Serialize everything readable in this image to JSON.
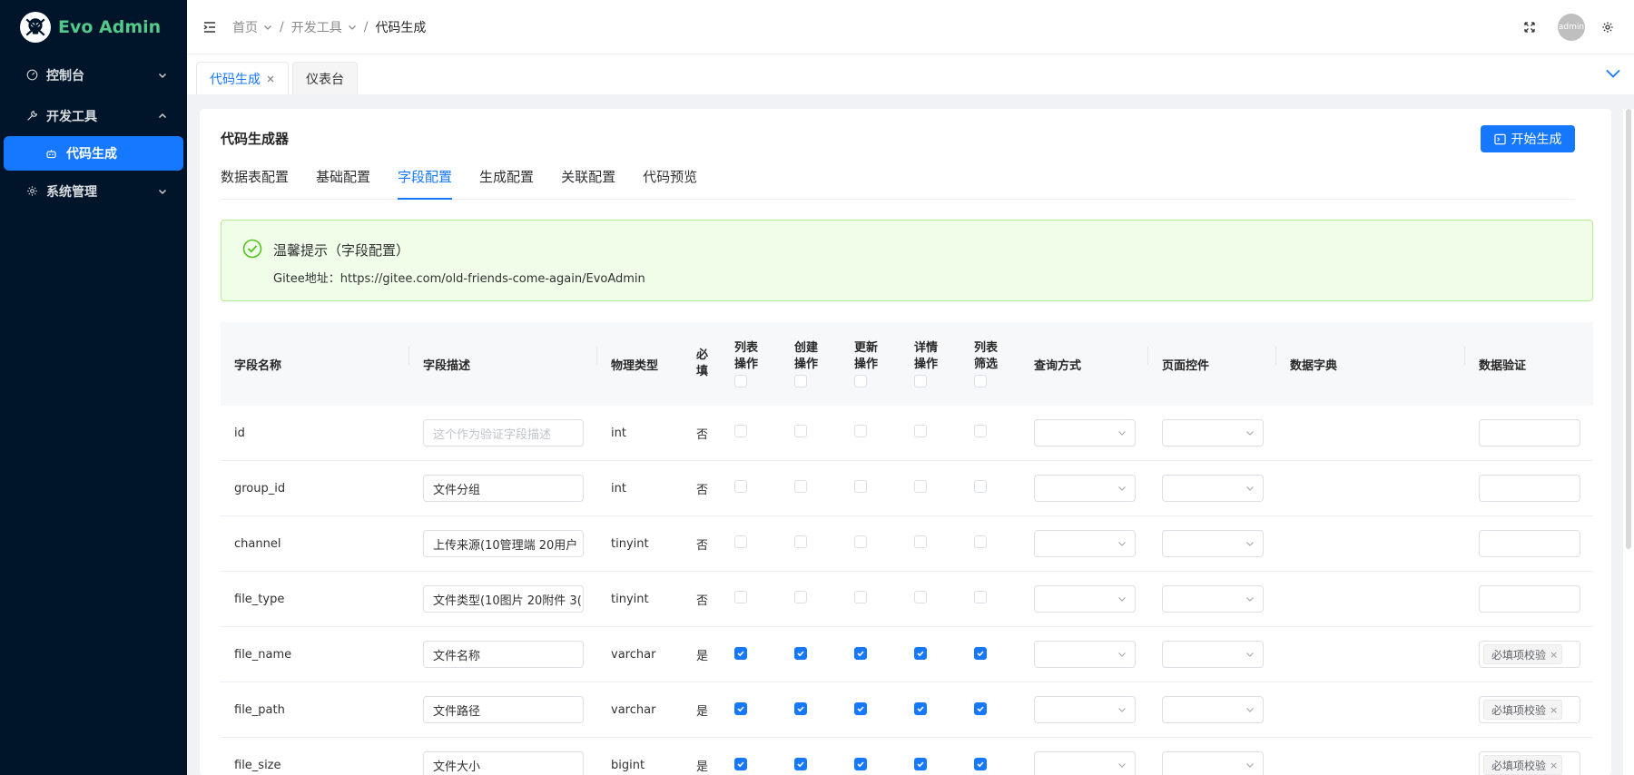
{
  "app": {
    "title": "Evo Admin",
    "logo_icon": "skull-logo-icon"
  },
  "sidebar": {
    "items": [
      {
        "label": "控制台",
        "icon": "dashboard-icon",
        "expanded": false
      },
      {
        "label": "开发工具",
        "icon": "tool-icon",
        "expanded": true
      },
      {
        "label": "代码生成",
        "icon": "robot-icon",
        "active": true
      },
      {
        "label": "系统管理",
        "icon": "gear-icon",
        "expanded": false
      }
    ]
  },
  "header": {
    "breadcrumb": [
      "首页",
      "开发工具",
      "代码生成"
    ],
    "avatar_text": "admin"
  },
  "tabs": [
    {
      "label": "代码生成",
      "active": true,
      "closable": true
    },
    {
      "label": "仪表台",
      "active": false
    }
  ],
  "page": {
    "title": "代码生成器",
    "generate_button": "开始生成",
    "config_tabs": [
      "数据表配置",
      "基础配置",
      "字段配置",
      "生成配置",
      "关联配置",
      "代码预览"
    ],
    "active_config_tab": "字段配置",
    "alert": {
      "title": "温馨提示（字段配置）",
      "desc": "Gitee地址：https://gitee.com/old-friends-come-again/EvoAdmin"
    }
  },
  "table": {
    "headers": {
      "name": "字段名称",
      "desc": "字段描述",
      "type": "物理类型",
      "required": [
        "必",
        "填"
      ],
      "list_op": [
        "列表",
        "操作"
      ],
      "create_op": [
        "创建",
        "操作"
      ],
      "update_op": [
        "更新",
        "操作"
      ],
      "detail_op": [
        "详情",
        "操作"
      ],
      "list_filter": [
        "列表",
        "筛选"
      ],
      "query": "查询方式",
      "control": "页面控件",
      "dict": "数据字典",
      "validation": "数据验证"
    },
    "rows": [
      {
        "name": "id",
        "desc": "",
        "desc_placeholder": "这个作为验证字段描述",
        "type": "int",
        "required": "否",
        "checks": [
          false,
          false,
          false,
          false,
          false
        ],
        "validation": ""
      },
      {
        "name": "group_id",
        "desc": "文件分组",
        "type": "int",
        "required": "否",
        "checks": [
          false,
          false,
          false,
          false,
          false
        ],
        "validation": ""
      },
      {
        "name": "channel",
        "desc": "上传来源(10管理端 20用户",
        "type": "tinyint",
        "required": "否",
        "checks": [
          false,
          false,
          false,
          false,
          false
        ],
        "validation": ""
      },
      {
        "name": "file_type",
        "desc": "文件类型(10图片 20附件 3(",
        "type": "tinyint",
        "required": "否",
        "checks": [
          false,
          false,
          false,
          false,
          false
        ],
        "validation": ""
      },
      {
        "name": "file_name",
        "desc": "文件名称",
        "type": "varchar",
        "required": "是",
        "checks": [
          true,
          true,
          true,
          true,
          true
        ],
        "validation": "必填项校验"
      },
      {
        "name": "file_path",
        "desc": "文件路径",
        "type": "varchar",
        "required": "是",
        "checks": [
          true,
          true,
          true,
          true,
          true
        ],
        "validation": "必填项校验"
      },
      {
        "name": "file_size",
        "desc": "文件大小",
        "type": "bigint",
        "required": "是",
        "checks": [
          true,
          true,
          true,
          true,
          true
        ],
        "validation": "必填项校验"
      }
    ]
  },
  "colors": {
    "primary": "#1677ff",
    "sidebar_bg": "#001529",
    "alert_bg": "#f0fde8",
    "alert_border": "#b7eb8f",
    "success": "#52c41a"
  }
}
